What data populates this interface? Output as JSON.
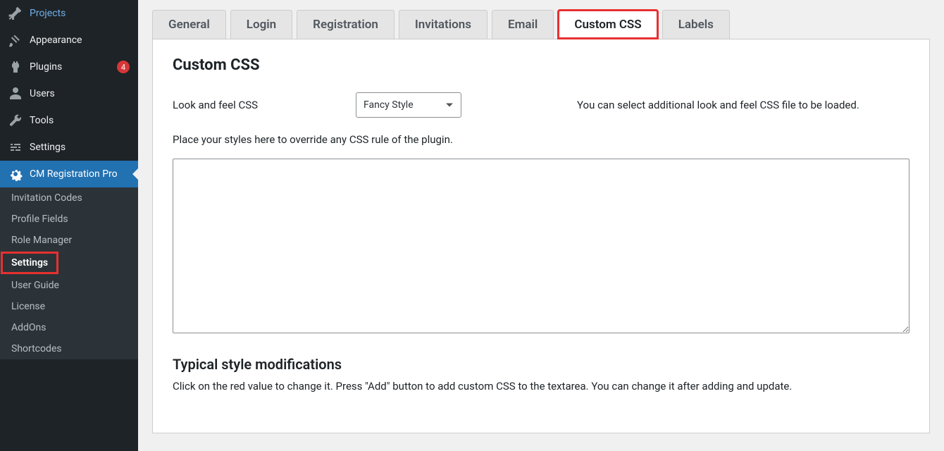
{
  "sidebar": {
    "items": [
      {
        "label": "Projects"
      },
      {
        "label": "Appearance"
      },
      {
        "label": "Plugins",
        "badge": "4"
      },
      {
        "label": "Users"
      },
      {
        "label": "Tools"
      },
      {
        "label": "Settings"
      },
      {
        "label": "CM Registration Pro"
      }
    ],
    "submenu": [
      {
        "label": "Invitation Codes"
      },
      {
        "label": "Profile Fields"
      },
      {
        "label": "Role Manager"
      },
      {
        "label": "Settings",
        "highlighted": true
      },
      {
        "label": "User Guide"
      },
      {
        "label": "License"
      },
      {
        "label": "AddOns"
      },
      {
        "label": "Shortcodes"
      }
    ]
  },
  "tabs": [
    {
      "label": "General"
    },
    {
      "label": "Login"
    },
    {
      "label": "Registration"
    },
    {
      "label": "Invitations"
    },
    {
      "label": "Email"
    },
    {
      "label": "Custom CSS"
    },
    {
      "label": "Labels"
    }
  ],
  "panel": {
    "heading": "Custom CSS",
    "look_label": "Look and feel CSS",
    "look_select": "Fancy Style",
    "look_desc": "You can select additional look and feel CSS file to be loaded.",
    "override_hint": "Place your styles here to override any CSS rule of the plugin.",
    "textarea_value": "",
    "section_heading": "Typical style modifications",
    "section_hint": "Click on the red value to change it. Press \"Add\" button to add custom CSS to the textarea. You can change it after adding and update."
  }
}
